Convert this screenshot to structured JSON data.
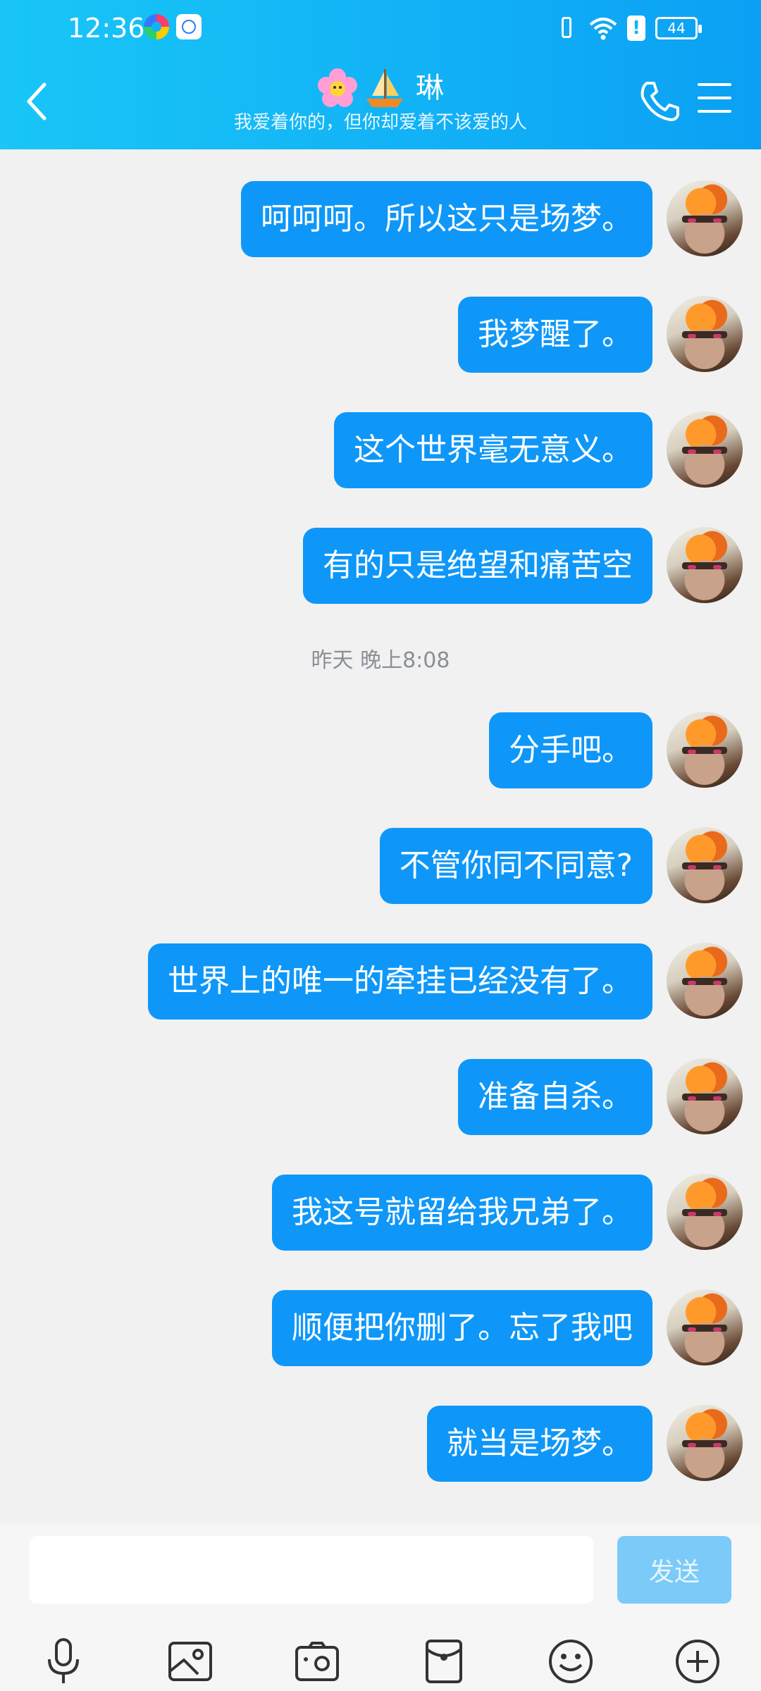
{
  "status_bar": {
    "time": "12:36",
    "battery": "44"
  },
  "header": {
    "contact_name": "琳",
    "subtitle": "我爱着你的，但你却爱着不该爱的人"
  },
  "messages": [
    {
      "text": "呵呵呵。所以这只是场梦。"
    },
    {
      "text": "我梦醒了。"
    },
    {
      "text": "这个世界毫无意义。"
    },
    {
      "text": "有的只是绝望和痛苦空"
    },
    {
      "text": "分手吧。"
    },
    {
      "text": "不管你同不同意?"
    },
    {
      "text": "世界上的唯一的牵挂已经没有了。"
    },
    {
      "text": "准备自杀。"
    },
    {
      "text": "我这号就留给我兄弟了。"
    },
    {
      "text": "顺便把你删了。忘了我吧"
    },
    {
      "text": "就当是场梦。"
    }
  ],
  "timestamp": "昨天 晚上8:08",
  "input": {
    "value": "",
    "send_label": "发送"
  },
  "toolbar": [
    "microphone-icon",
    "image-icon",
    "camera-icon",
    "red-packet-icon",
    "emoji-icon",
    "plus-icon"
  ],
  "colors": {
    "header": "#12b2f6",
    "bubble": "#0e97f8",
    "send_disabled": "#7ccaf8",
    "background": "#f1f1f1"
  }
}
